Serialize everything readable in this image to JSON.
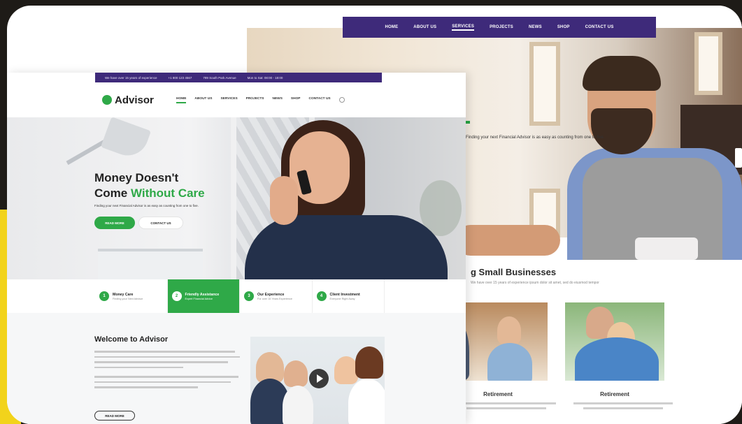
{
  "back_page": {
    "nav": [
      "HOME",
      "ABOUT US",
      "SERVICES",
      "PROJECTS",
      "NEWS",
      "SHOP",
      "CONTACT US"
    ],
    "nav_active": "SERVICES",
    "hero_sub": "Finding your next Financial Advisor is as easy as counting from one to five.",
    "section_title": "g Small Businesses",
    "section_sub": "We have over 15 years of experience ipsum dolor sit amet, sed do eiusmod tempor",
    "cards": [
      {
        "title": "Retirement"
      },
      {
        "title": "Retirement"
      }
    ]
  },
  "front_page": {
    "topbar": [
      "We have over 15 years of experience",
      "+1 800 123 4567",
      "789 South Park Avenue",
      "Mon to Sat: 08:00 - 18:00"
    ],
    "logo": "Advisor",
    "nav": [
      "HOME",
      "ABOUT US",
      "SERVICES",
      "PROJECTS",
      "NEWS",
      "SHOP",
      "CONTACT US"
    ],
    "nav_active": "HOME",
    "hero": {
      "title_line1": "Money Doesn't",
      "title_line2_plain": "Come ",
      "title_line2_green": "Without Care",
      "subtitle": "Finding your next Financial Advisor is as easy as counting from one to five.",
      "btn_primary": "READ MORE",
      "btn_secondary": "CONTACT US"
    },
    "features": [
      {
        "num": "1",
        "title": "Money Care",
        "sub": "Finding your Next Advisor"
      },
      {
        "num": "2",
        "title": "Friendly Assistance",
        "sub": "Expert Financial Advice"
      },
      {
        "num": "3",
        "title": "Our Experience",
        "sub": "For over 15 Years Experience"
      },
      {
        "num": "4",
        "title": "Client Investment",
        "sub": "Everyone Right Away"
      }
    ],
    "active_feature": 1,
    "welcome": {
      "title": "Welcome to Advisor",
      "read_more": "READ MORE"
    }
  },
  "colors": {
    "brand_green": "#2fa948",
    "brand_purple": "#3e2a7a",
    "frame_yellow": "#f2d31b",
    "frame_dark": "#1e1b17"
  }
}
